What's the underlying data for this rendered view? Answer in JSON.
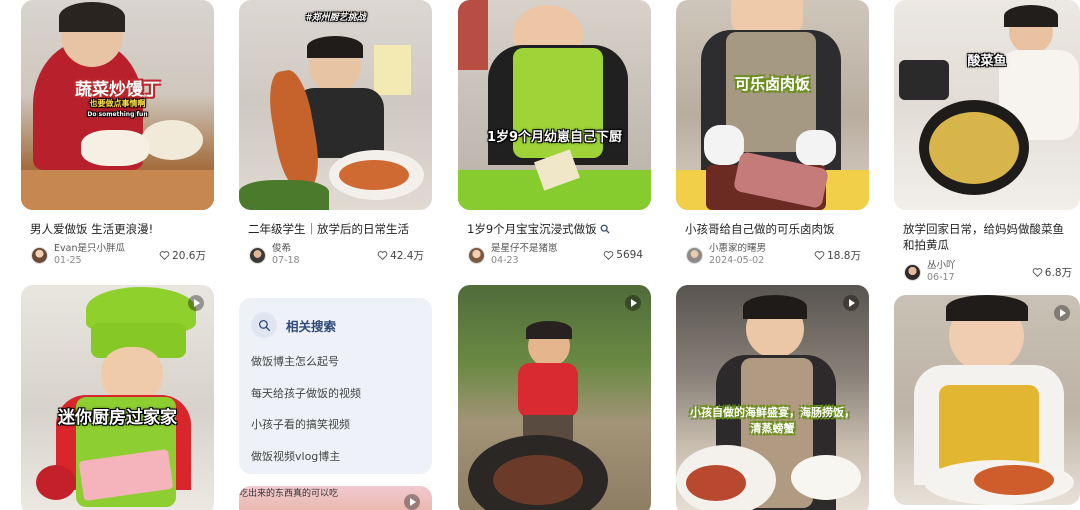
{
  "feed": {
    "row1": [
      {
        "overlay": "蔬菜炒馒丁",
        "overlay_sub": "也要做点事情啊",
        "overlay_sub2": "Do something fun",
        "title": "男人爱做饭 生活更浪漫!",
        "author": "Evan是只小胖瓜",
        "date": "01-25",
        "likes": "20.6万"
      },
      {
        "overlay": "#郑州厨艺挑战",
        "title": "二年级学生｜放学后的日常生活",
        "author": "俊希",
        "date": "07-18",
        "likes": "42.4万"
      },
      {
        "overlay": "1岁9个月幼崽自己下厨",
        "title": "1岁9个月宝宝沉浸式做饭",
        "author": "是星仔不是猪崽",
        "date": "04-23",
        "likes": "5694"
      },
      {
        "overlay": "可乐卤肉饭",
        "title": "小孩哥给自己做的可乐卤肉饭",
        "author": "小惠家的曙男",
        "date": "2024-05-02",
        "likes": "18.8万"
      },
      {
        "overlay": "酸菜鱼",
        "title": "放学回家日常，给妈妈做酸菜鱼和拍黄瓜",
        "author": "丛小吖",
        "date": "06-17",
        "likes": "6.8万"
      }
    ],
    "row2": [
      {
        "overlay": "迷你厨房过家家"
      },
      {
        "overlay": ""
      },
      {
        "overlay": "小孩自做的海鲜盛宴，海肠捞饭，清蒸螃蟹"
      },
      {
        "overlay": ""
      }
    ]
  },
  "related_search": {
    "heading": "相关搜索",
    "items": [
      "做饭博主怎么起号",
      "每天给孩子做饭的视频",
      "小孩子看的搞笑视频",
      "做饭视频vlog博主"
    ]
  },
  "partial_card": {
    "overlay": "吃出来的东西真的可以吃"
  },
  "colors": {
    "like_icon": "#555555",
    "related_bg": "#eef2f8",
    "related_heading": "#2f4a77"
  }
}
